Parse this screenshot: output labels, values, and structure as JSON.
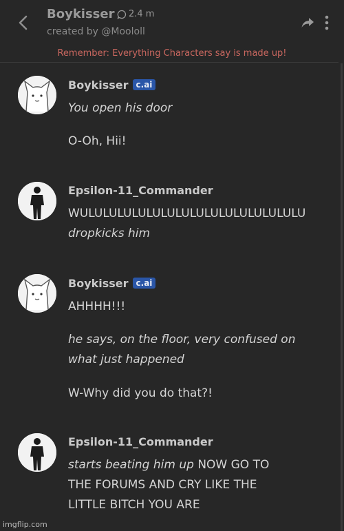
{
  "header": {
    "title": "Boykisser",
    "message_count": "2.4 m",
    "creator": "created by @Moololl"
  },
  "disclaimer": "Remember: Everything Characters say is made up!",
  "messages": [
    {
      "name": "Boykisser",
      "badge": "c.ai",
      "lines": [
        "You open his door",
        "O-Oh, Hii!"
      ]
    },
    {
      "name": "Epsilon-11_Commander",
      "lines": [
        "WULULULULULULULULULULULULULULULU",
        "dropkicks him"
      ]
    },
    {
      "name": "Boykisser",
      "badge": "c.ai",
      "lines": [
        "AHHHH!!!",
        "he says, on the floor, very confused on",
        "what just happened",
        "W-Why did you do that?!"
      ]
    },
    {
      "name": "Epsilon-11_Commander",
      "lines": [
        "starts beating him up",
        "NOW GO TO",
        "THE FORUMS AND CRY LIKE THE",
        "LITTLE BITCH YOU ARE"
      ]
    }
  ],
  "footer": "imgflip.com"
}
